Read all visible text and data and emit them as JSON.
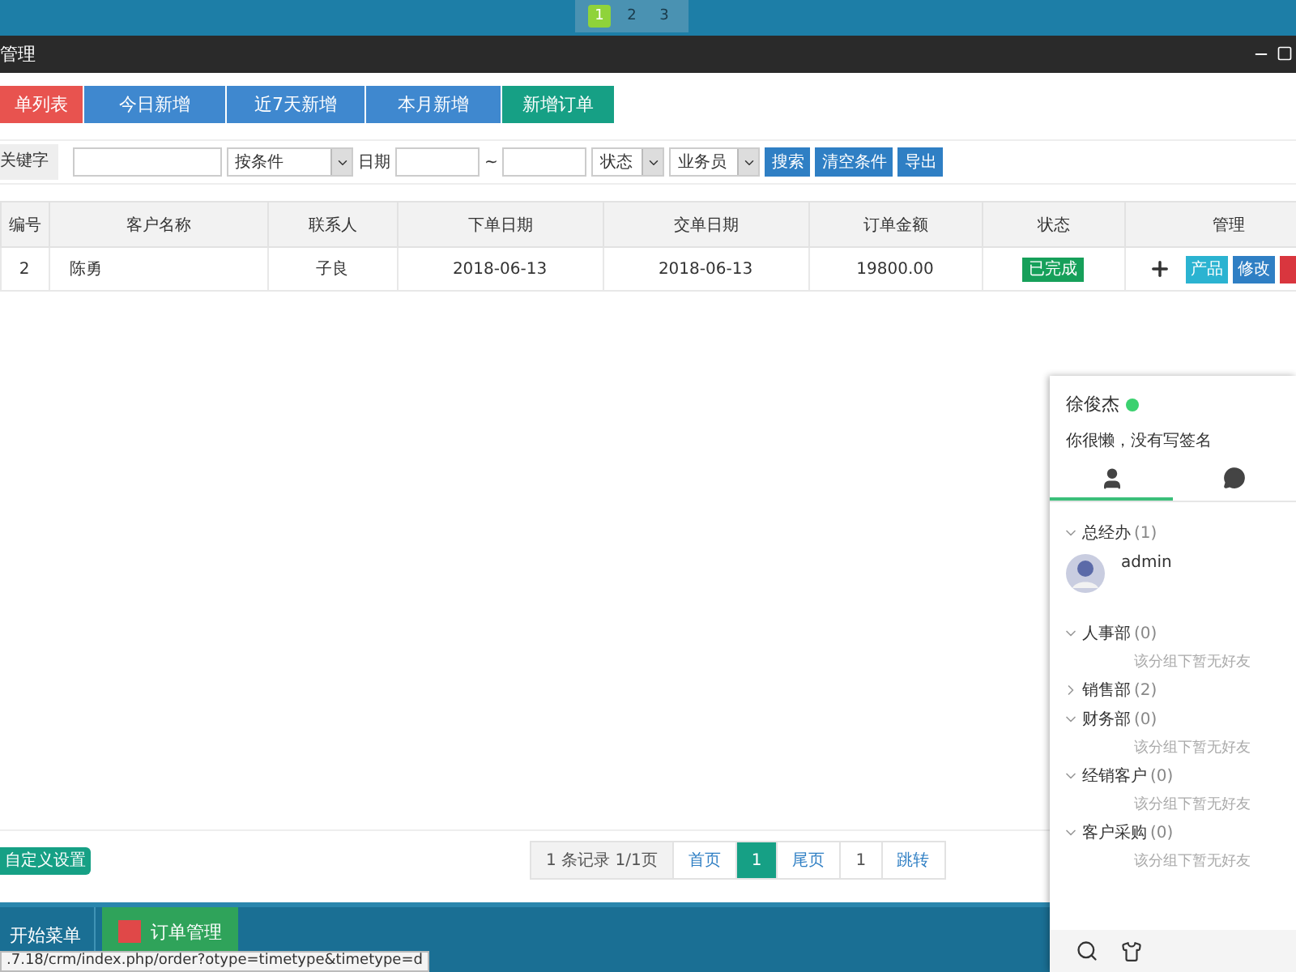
{
  "top_pager": [
    {
      "label": "1",
      "selected": true
    },
    {
      "label": "2",
      "selected": false
    },
    {
      "label": "3",
      "selected": false
    }
  ],
  "window": {
    "title": "管理"
  },
  "tabs": [
    {
      "label": "单列表",
      "kind": "list",
      "selected": true
    },
    {
      "label": "今日新增",
      "kind": "list",
      "selected": false
    },
    {
      "label": "近7天新增",
      "kind": "list",
      "selected": false
    },
    {
      "label": "本月新增",
      "kind": "list",
      "selected": false
    },
    {
      "label": "新增订单",
      "kind": "add",
      "selected": false
    }
  ],
  "filters": {
    "keyword_label": "关键字",
    "condition": "按条件",
    "date_label": "日期",
    "range_sep": "~",
    "status": "状态",
    "salesman": "业务员",
    "buttons": [
      "搜索",
      "清空条件",
      "导出"
    ]
  },
  "table": {
    "columns": [
      "编号",
      "客户名称",
      "联系人",
      "下单日期",
      "交单日期",
      "订单金额",
      "状态",
      "管理"
    ],
    "rows": [
      {
        "cells": [
          "2",
          "陈勇",
          "子良",
          "2018-06-13",
          "2018-06-13",
          "19800.00"
        ],
        "status": "已完成",
        "actions": [
          {
            "kind": "add"
          },
          {
            "kind": "text",
            "label": "产品",
            "color": "#2bb3d1"
          },
          {
            "kind": "text",
            "label": "修改",
            "color": "#2f7fc4"
          },
          {
            "kind": "edge",
            "color": "#d9363e"
          }
        ]
      }
    ]
  },
  "footer": {
    "settings_button": "自定义设置",
    "pager": [
      {
        "kind": "info",
        "label": "1 条记录 1/1页",
        "selected": false
      },
      {
        "kind": "link",
        "label": "首页",
        "selected": false
      },
      {
        "kind": "page",
        "label": "1",
        "selected": true
      },
      {
        "kind": "link",
        "label": "尾页",
        "selected": false
      },
      {
        "kind": "input",
        "label": "1",
        "selected": false
      },
      {
        "kind": "link",
        "label": "跳转",
        "selected": false
      }
    ]
  },
  "taskbar": {
    "start": "开始菜单",
    "tasks": [
      {
        "label": "订单管理",
        "selected": true
      }
    ],
    "status_url": ".7.18/crm/index.php/order?otype=timetype&timetype=d"
  },
  "chat": {
    "user": "徐俊杰",
    "online": true,
    "signature": "你很懒，没有写签名",
    "tabs": [
      {
        "kind": "contacts",
        "selected": true
      },
      {
        "kind": "chat",
        "selected": false
      }
    ],
    "groups": [
      {
        "name": "总经办",
        "count": "(1)",
        "expanded": true,
        "members": [
          "admin"
        ]
      },
      {
        "name": "人事部",
        "count": "(0)",
        "expanded": true,
        "empty_text": "该分组下暂无好友"
      },
      {
        "name": "销售部",
        "count": "(2)",
        "expanded": false
      },
      {
        "name": "财务部",
        "count": "(0)",
        "expanded": true,
        "empty_text": "该分组下暂无好友"
      },
      {
        "name": "经销客户",
        "count": "(0)",
        "expanded": true,
        "empty_text": "该分组下暂无好友"
      },
      {
        "name": "客户采购",
        "count": "(0)",
        "expanded": true,
        "empty_text": "该分组下暂无好友"
      }
    ]
  }
}
